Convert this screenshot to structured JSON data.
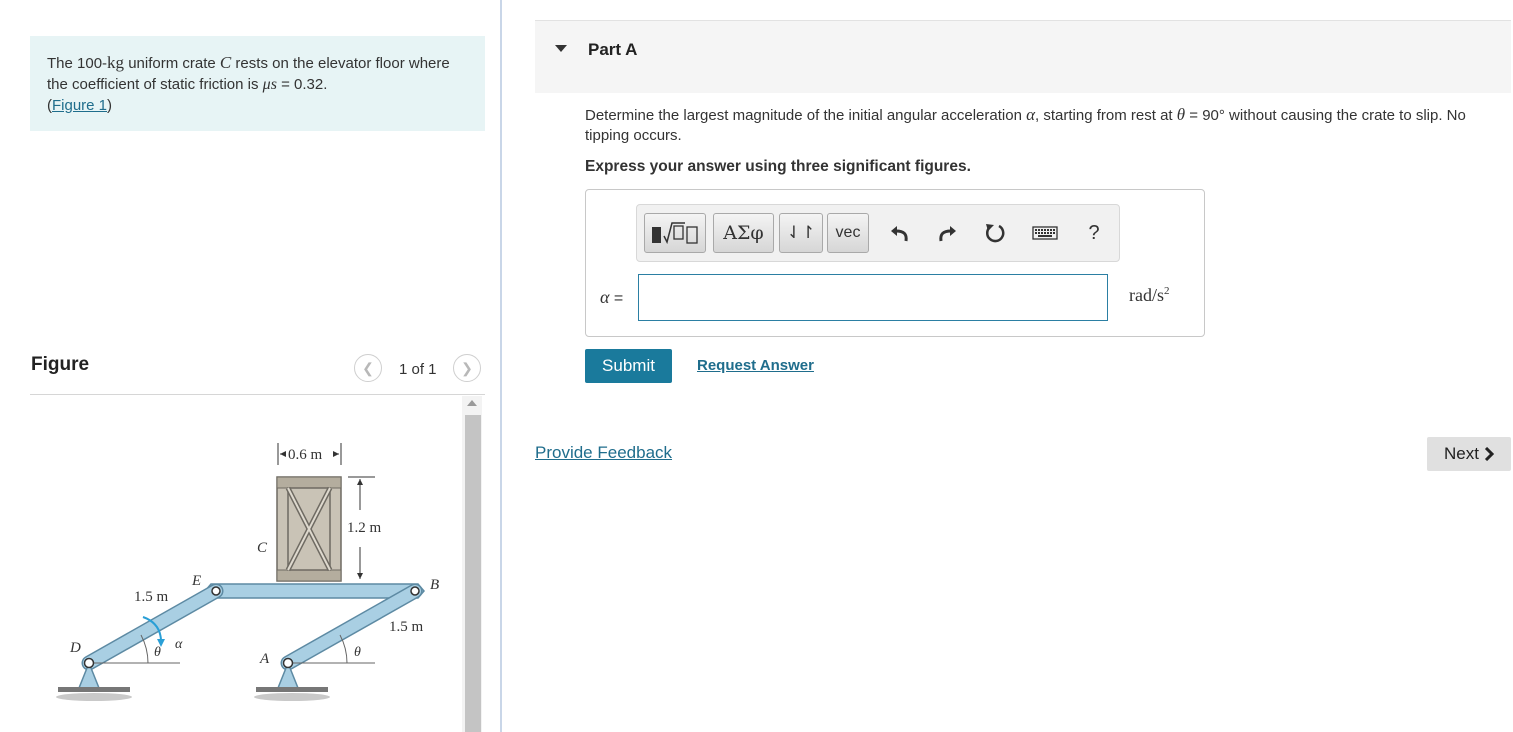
{
  "problem": {
    "text_1": "The 100-",
    "mass_unit": "kg",
    "text_2": " uniform crate ",
    "crate_symbol": "C",
    "text_3": " rests on the elevator floor where the coefficient of static friction is ",
    "mu_symbol": "μs",
    "text_4": " = 0.32.",
    "figure_link": "Figure 1"
  },
  "figure": {
    "title": "Figure",
    "pagination": "1 of 1",
    "labels": {
      "width_dim": "0.6 m",
      "height_dim": "1.2 m",
      "crate": "C",
      "point_e": "E",
      "point_b": "B",
      "point_d": "D",
      "point_a": "A",
      "left_link_len": "1.5 m",
      "right_link_len": "1.5 m",
      "theta": "θ",
      "alpha": "α"
    }
  },
  "part": {
    "title": "Part A",
    "question_1": "Determine the largest magnitude of the initial angular acceleration ",
    "question_alpha": "α",
    "question_2": ", starting from rest at ",
    "question_theta": "θ",
    "question_3": " = 90° without causing the crate to slip. No tipping occurs.",
    "instruction": "Express your answer using three significant figures."
  },
  "toolbar": {
    "greek": "ΑΣφ",
    "arrows": "⇃↾",
    "vec": "vec",
    "help": "?",
    "icons": [
      "templates-icon",
      "undo-icon",
      "redo-icon",
      "reset-icon",
      "keyboard-icon",
      "help-icon"
    ]
  },
  "answer": {
    "label": "α =",
    "value": "",
    "unit_base": "rad/s",
    "unit_exp": "2"
  },
  "actions": {
    "submit": "Submit",
    "request_answer": "Request Answer",
    "provide_feedback": "Provide Feedback",
    "next": "Next"
  },
  "colors": {
    "accent": "#1a7a9c",
    "link": "#1f6d8c",
    "problem_bg": "#e7f4f5",
    "beam_fill": "#a9cfe3"
  }
}
